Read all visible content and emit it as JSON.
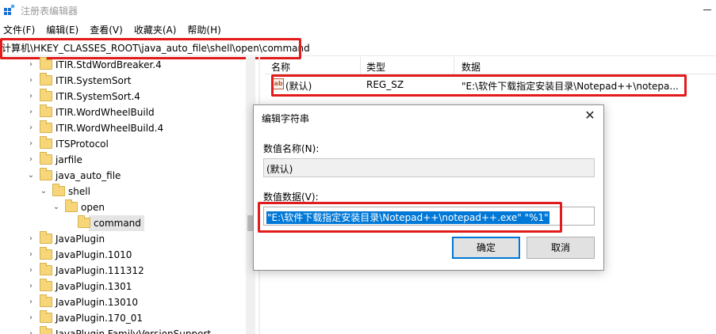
{
  "window": {
    "title": "注册表编辑器",
    "icon": "regedit-icon"
  },
  "menu": [
    "文件(F)",
    "编辑(E)",
    "查看(V)",
    "收藏夹(A)",
    "帮助(H)"
  ],
  "address": "计算机\\HKEY_CLASSES_ROOT\\java_auto_file\\shell\\open\\command",
  "tree": [
    {
      "label": "ITIR.StdWordBreaker.4",
      "level": 0,
      "chevron": ">"
    },
    {
      "label": "ITIR.SystemSort",
      "level": 0,
      "chevron": ">"
    },
    {
      "label": "ITIR.SystemSort.4",
      "level": 0,
      "chevron": ">"
    },
    {
      "label": "ITIR.WordWheelBuild",
      "level": 0,
      "chevron": ">"
    },
    {
      "label": "ITIR.WordWheelBuild.4",
      "level": 0,
      "chevron": ">"
    },
    {
      "label": "ITSProtocol",
      "level": 0,
      "chevron": ">"
    },
    {
      "label": "jarfile",
      "level": 0,
      "chevron": ">"
    },
    {
      "label": "java_auto_file",
      "level": 0,
      "chevron": "v"
    },
    {
      "label": "shell",
      "level": 1,
      "chevron": "v"
    },
    {
      "label": "open",
      "level": 2,
      "chevron": "v"
    },
    {
      "label": "command",
      "level": 3,
      "chevron": "",
      "selected": true
    },
    {
      "label": "JavaPlugin",
      "level": 0,
      "chevron": ">"
    },
    {
      "label": "JavaPlugin.1010",
      "level": 0,
      "chevron": ">"
    },
    {
      "label": "JavaPlugin.111312",
      "level": 0,
      "chevron": ">"
    },
    {
      "label": "JavaPlugin.1301",
      "level": 0,
      "chevron": ">"
    },
    {
      "label": "JavaPlugin.13010",
      "level": 0,
      "chevron": ">"
    },
    {
      "label": "JavaPlugin.170_01",
      "level": 0,
      "chevron": ">"
    },
    {
      "label": "JavaPlugin.FamilyVersionSupport",
      "level": 0,
      "chevron": ">"
    }
  ],
  "values": {
    "headers": {
      "name": "名称",
      "type": "类型",
      "data": "数据"
    },
    "rows": [
      {
        "icon": "ab",
        "name": "(默认)",
        "type": "REG_SZ",
        "data": "\"E:\\软件下载指定安装目录\\Notepad++\\notepa..."
      }
    ]
  },
  "dialog": {
    "title": "编辑字符串",
    "value_name_label": "数值名称(N):",
    "value_name": "(默认)",
    "value_data_label": "数值数据(V):",
    "value_data": "\"E:\\软件下载指定安装目录\\Notepad++\\notepad++.exe\" \"%1\"",
    "ok_label": "确定",
    "cancel_label": "取消",
    "close_glyph": "✕"
  },
  "colors": {
    "annotation_red": "#e21b1b",
    "selection_blue": "#0078d7",
    "folder_yellow": "#f7d67a"
  }
}
